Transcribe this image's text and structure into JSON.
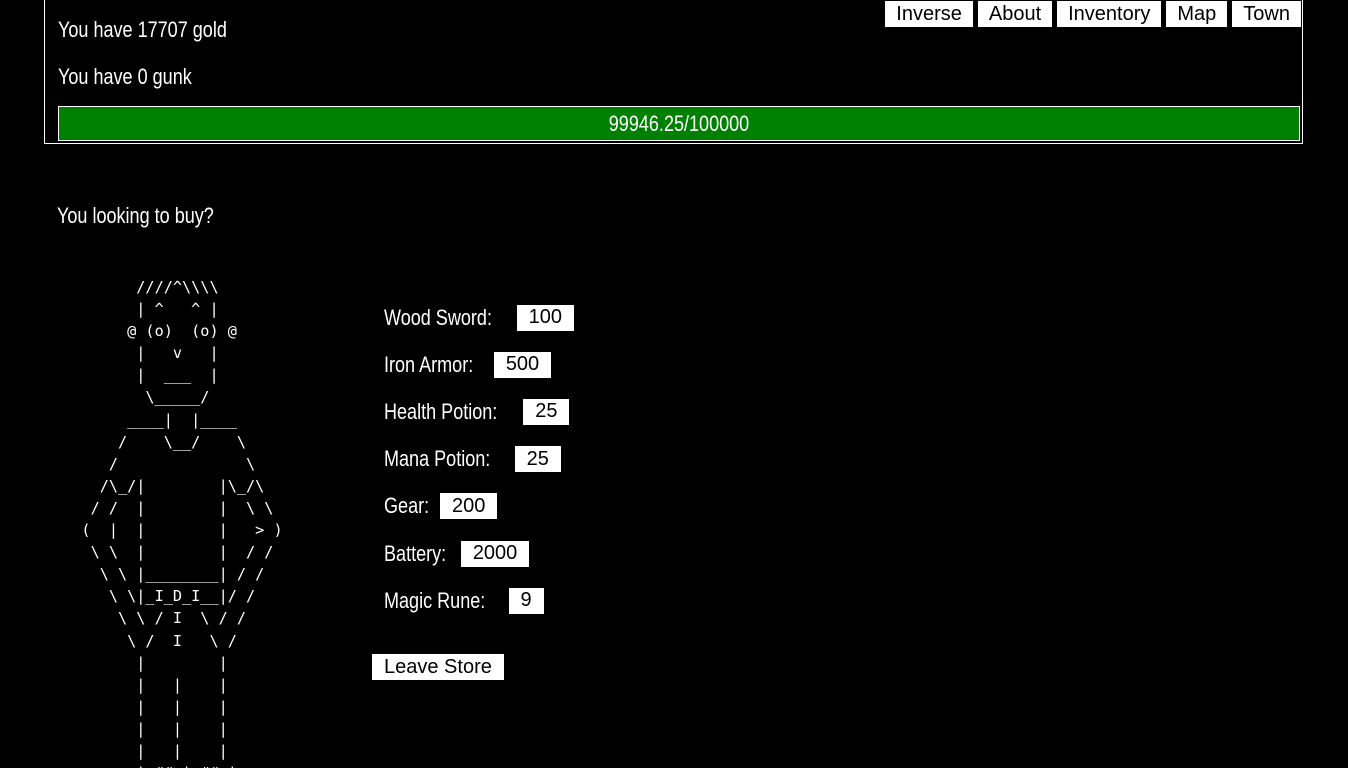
{
  "status": {
    "gold_text": "You have 17707 gold",
    "gunk_text": "You have 0 gunk",
    "progress_text": "99946.25/100000",
    "progress_current": 99946.25,
    "progress_max": 100000,
    "bar_color": "#008000"
  },
  "nav": {
    "inverse": "Inverse",
    "about": "About",
    "inventory": "Inventory",
    "map": "Map",
    "town": "Town"
  },
  "shop": {
    "prompt": "You looking to buy?",
    "items": [
      {
        "name": "Wood Sword:",
        "price": "100"
      },
      {
        "name": "Iron Armor:",
        "price": "500"
      },
      {
        "name": "Health Potion:",
        "price": "25"
      },
      {
        "name": "Mana Potion:",
        "price": "25"
      },
      {
        "name": "Gear:",
        "price": "200"
      },
      {
        "name": "Battery:",
        "price": "2000"
      },
      {
        "name": "Magic Rune:",
        "price": "9"
      }
    ],
    "leave_label": "Leave Store"
  },
  "shopkeeper_art": "         ////^\\\\\\\\\n         | ^   ^ |\n        @ (o)  (o) @\n         |   v   |\n         |  ___  |\n          \\_____/\n        ____|  |____\n       /    \\__/    \\\n      /              \\\n     /\\_/|        |\\_/\\\n    / /  |        |  \\ \\\n   (  |  |        |   > )\n    \\ \\  |        |  / /\n     \\ \\ |________| / /\n      \\ \\|_I_D_I__|/ /\n       \\ \\ / I  \\ / /\n        \\ /  I   \\ /\n         |        |\n         |   |    |\n         |   |    |\n         |   |    |\n         |   |    |\n         | ## | ## |"
}
